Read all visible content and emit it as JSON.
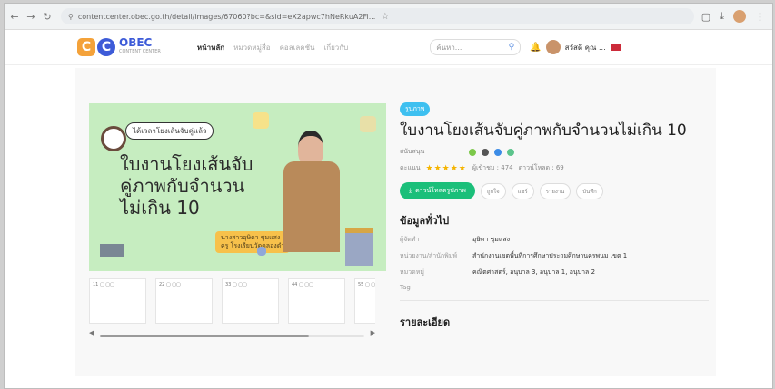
{
  "browser": {
    "url": "contentcenter.obec.go.th/detail/images/67060?bc=&sid=eX2apwc7hNeRkuA2Fi...",
    "icons": [
      "back-icon",
      "forward-icon",
      "reload-icon",
      "star-icon",
      "extensions-icon",
      "download-icon",
      "profile-icon",
      "more-icon"
    ]
  },
  "header": {
    "logo_primary": "OBEC",
    "logo_secondary": "CONTENT CENTER",
    "logo_letters": [
      "C",
      "C"
    ],
    "nav": [
      "หน้าหลัก",
      "หมวดหมู่สื่อ",
      "คอลเลคชัน",
      "เกี่ยวกับ"
    ],
    "search_placeholder": "ค้นหา...",
    "user_name": "สวัสดี คุณ ...",
    "colors": {
      "accent": "#3d5bd8",
      "orange": "#f4a23a"
    }
  },
  "cover": {
    "bubble": "ได้เวลาโยงเส้นจับคู่แล้ว",
    "line1": "ใบงานโยงเส้นจับ",
    "line2": "คู่ภาพกับจำนวน",
    "line3": "ไม่เกิน 10",
    "author_pill": "นางสาวอุษิดา ชุมแสง\nครู โรงเรียนวัดคลองดำ"
  },
  "thumbnails": [
    "11 ▢ ▢▢",
    "22 ▢ ▢▢",
    "33 ▢ ▢▢",
    "44 ▢ ▢▢",
    "55 ▢ ▢▢"
  ],
  "info": {
    "tag": "รูปภาพ",
    "title": "ใบงานโยงเส้นจับคู่ภาพกับจำนวนไม่เกิน 10",
    "support_label": "สนับสนุน",
    "rating_label": "คะแนน",
    "stars": "★★★★★",
    "views": "ผู้เข้าชม : 474",
    "downloads": "ดาวน์โหลด : 69",
    "download_button": "ดาวน์โหลดรูปภาพ",
    "action_buttons": [
      "ถูกใจ",
      "แชร์",
      "รายงาน",
      "บันทึก"
    ],
    "section_general": "ข้อมูลทั่วไป",
    "fields": [
      {
        "k": "ผู้จัดทำ",
        "v": "อุษิดา ชุมแสง"
      },
      {
        "k": "หน่วยงาน/สำนักพิมพ์",
        "v": "สำนักงานเขตพื้นที่การศึกษาประถมศึกษานครพนม เขต 1"
      },
      {
        "k": "หมวดหมู่",
        "v": "คณิตศาสตร์, อนุบาล 3, อนุบาล 1, อนุบาล 2"
      },
      {
        "k": "Tag",
        "v": ""
      }
    ],
    "section_detail": "รายละเอียด"
  }
}
